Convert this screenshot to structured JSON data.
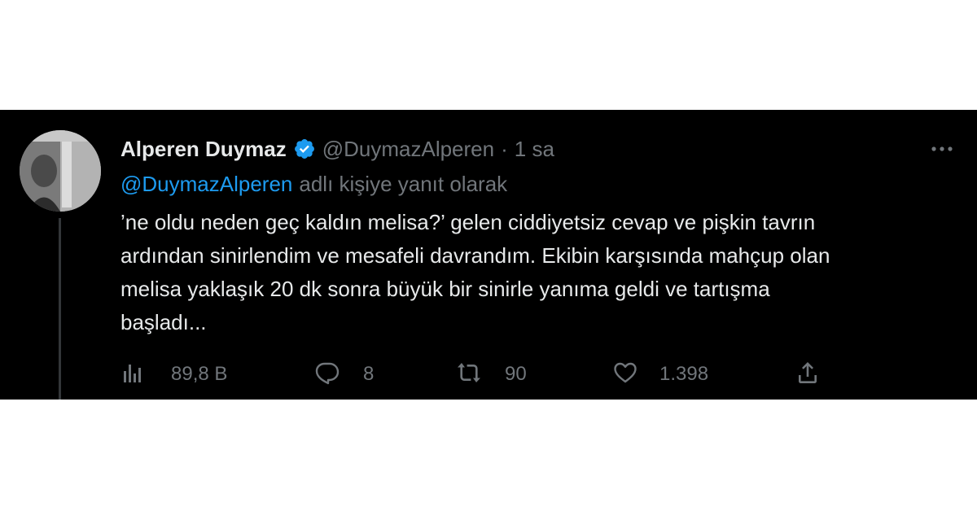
{
  "tweet": {
    "author": {
      "display_name": "Alperen Duymaz",
      "handle": "@DuymazAlperen",
      "verified": true
    },
    "separator": "·",
    "time": "1 sa",
    "reply_to": {
      "handle": "@DuymazAlperen",
      "suffix": "adlı kişiye yanıt olarak"
    },
    "text_lines": [
      "’ne oldu neden geç kaldın melisa?’  gelen ciddiyetsiz cevap ve pişkin tavrın",
      "ardından sinirlendim ve mesafeli davrandım. Ekibin karşısında mahçup olan",
      "melisa yaklaşık 20 dk sonra büyük bir sinirle yanıma geldi ve tartışma",
      "başladı..."
    ],
    "actions": {
      "views": "89,8 B",
      "replies": "8",
      "retweets": "90",
      "likes": "1.398"
    }
  },
  "icons": {
    "verified": "verified-badge-icon",
    "more": "more-options-icon",
    "views": "analytics-icon",
    "reply": "reply-icon",
    "retweet": "retweet-icon",
    "like": "heart-icon",
    "share": "share-icon"
  },
  "colors": {
    "background": "#000000",
    "text_primary": "#e7e9ea",
    "text_secondary": "#71767b",
    "accent": "#1d9bf0",
    "thread_line": "#333639"
  }
}
